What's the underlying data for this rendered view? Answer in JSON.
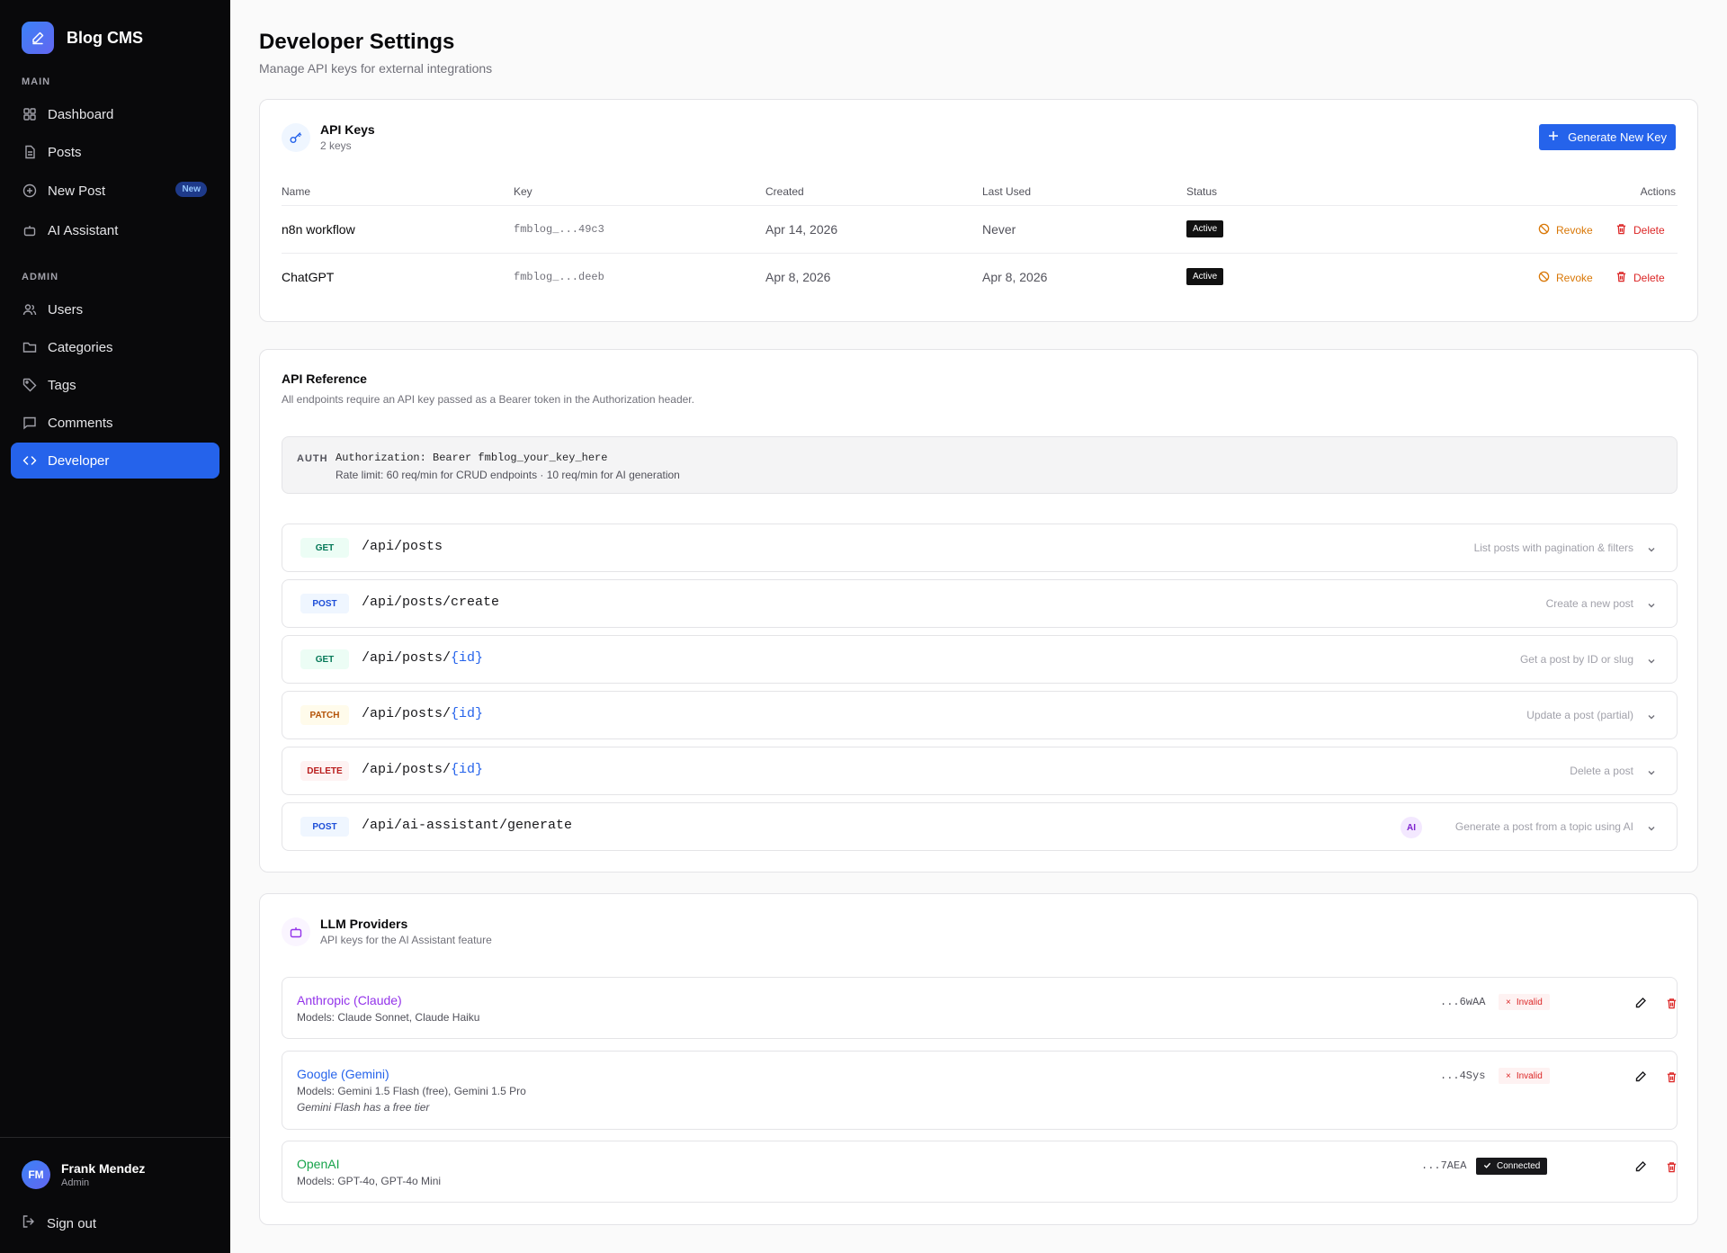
{
  "app": {
    "name": "Blog CMS"
  },
  "sidebar": {
    "sections": {
      "main": "MAIN",
      "admin": "ADMIN"
    },
    "main_items": [
      {
        "label": "Dashboard",
        "icon": "dashboard-icon"
      },
      {
        "label": "Posts",
        "icon": "file-icon"
      },
      {
        "label": "New Post",
        "icon": "plus-circle-icon",
        "badge": "New"
      },
      {
        "label": "AI Assistant",
        "icon": "bot-icon"
      }
    ],
    "admin_items": [
      {
        "label": "Users",
        "icon": "users-icon"
      },
      {
        "label": "Categories",
        "icon": "folder-icon"
      },
      {
        "label": "Tags",
        "icon": "tag-icon"
      },
      {
        "label": "Comments",
        "icon": "comment-icon"
      },
      {
        "label": "Developer",
        "icon": "code-icon",
        "active": true
      }
    ],
    "user": {
      "initials": "FM",
      "name": "Frank Mendez",
      "role": "Admin"
    },
    "signout": "Sign out"
  },
  "header": {
    "title": "Developer Settings",
    "subtitle": "Manage API keys for external integrations"
  },
  "api_keys": {
    "title": "API Keys",
    "count": "2 keys",
    "generate_label": "Generate New Key",
    "columns": {
      "name": "Name",
      "key": "Key",
      "created": "Created",
      "last_used": "Last Used",
      "status": "Status",
      "actions": "Actions"
    },
    "rows": [
      {
        "name": "n8n workflow",
        "key": "fmblog_...49c3",
        "created": "Apr 14, 2026",
        "last_used": "Never",
        "status": "Active"
      },
      {
        "name": "ChatGPT",
        "key": "fmblog_...deeb",
        "created": "Apr 8, 2026",
        "last_used": "Apr 8, 2026",
        "status": "Active"
      }
    ],
    "revoke_label": "Revoke",
    "delete_label": "Delete"
  },
  "api_reference": {
    "title": "API Reference",
    "subtitle": "All endpoints require an API key passed as a Bearer token in the Authorization header.",
    "auth_label": "AUTH",
    "auth_value": "Authorization: Bearer fmblog_your_key_here",
    "rate_limit": "Rate limit: 60 req/min for CRUD endpoints · 10 req/min for AI generation",
    "endpoints": [
      {
        "method": "GET",
        "path": "/api/posts",
        "param": "",
        "description": "List posts with pagination & filters"
      },
      {
        "method": "POST",
        "path": "/api/posts/create",
        "param": "",
        "description": "Create a new post"
      },
      {
        "method": "GET",
        "path": "/api/posts/",
        "param": "{id}",
        "description": "Get a post by ID or slug"
      },
      {
        "method": "PATCH",
        "path": "/api/posts/",
        "param": "{id}",
        "description": "Update a post (partial)"
      },
      {
        "method": "DELETE",
        "path": "/api/posts/",
        "param": "{id}",
        "description": "Delete a post"
      },
      {
        "method": "POST",
        "path": "/api/ai-assistant/generate",
        "param": "",
        "description": "Generate a post from a topic using AI",
        "tag": "AI"
      }
    ]
  },
  "llm_providers": {
    "title": "LLM Providers",
    "subtitle": "API keys for the AI Assistant feature",
    "providers": [
      {
        "name": "Anthropic (Claude)",
        "color": "#9333ea",
        "models": "Models: Claude Sonnet, Claude Haiku",
        "note": "",
        "key": "...6wAA",
        "status": "Invalid"
      },
      {
        "name": "Google (Gemini)",
        "color": "#2563eb",
        "models": "Models: Gemini 1.5 Flash (free), Gemini 1.5 Pro",
        "note": "Gemini Flash has a free tier",
        "key": "...4Sys",
        "status": "Invalid"
      },
      {
        "name": "OpenAI",
        "color": "#16a34a",
        "models": "Models: GPT-4o, GPT-4o Mini",
        "note": "",
        "key": "...7AEA",
        "status": "Connected"
      }
    ]
  }
}
